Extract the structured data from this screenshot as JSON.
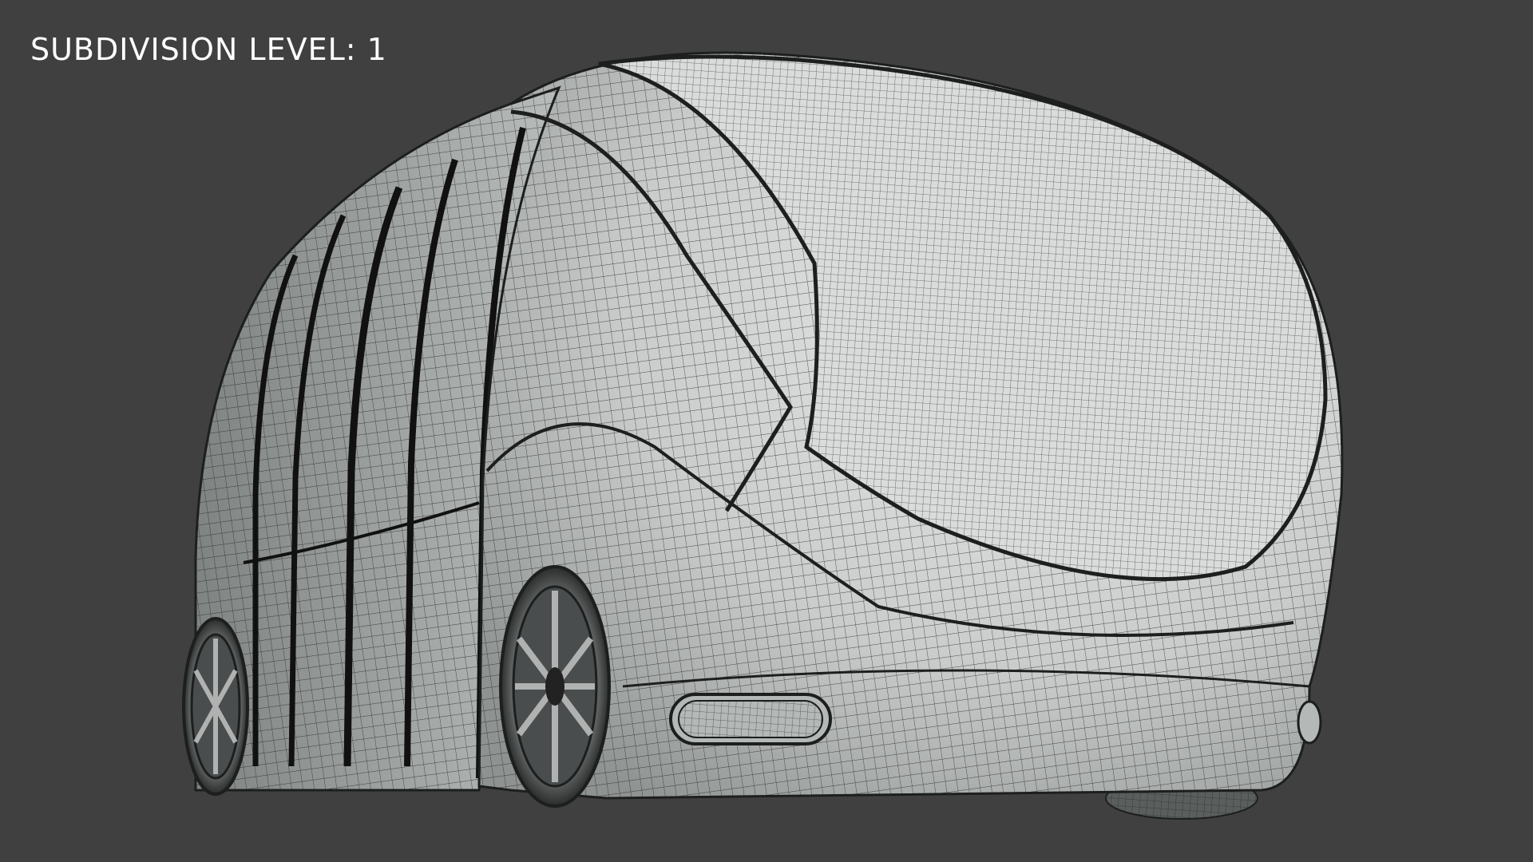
{
  "viewport": {
    "overlay_label": "SUBDIVISION LEVEL: 1",
    "background_color": "#404040",
    "model": "wireframe-autonomous-pod-vehicle",
    "shading": "solid-with-wireframe",
    "mesh_color": "#d4d7d6",
    "wire_color": "#1d1f1f"
  }
}
